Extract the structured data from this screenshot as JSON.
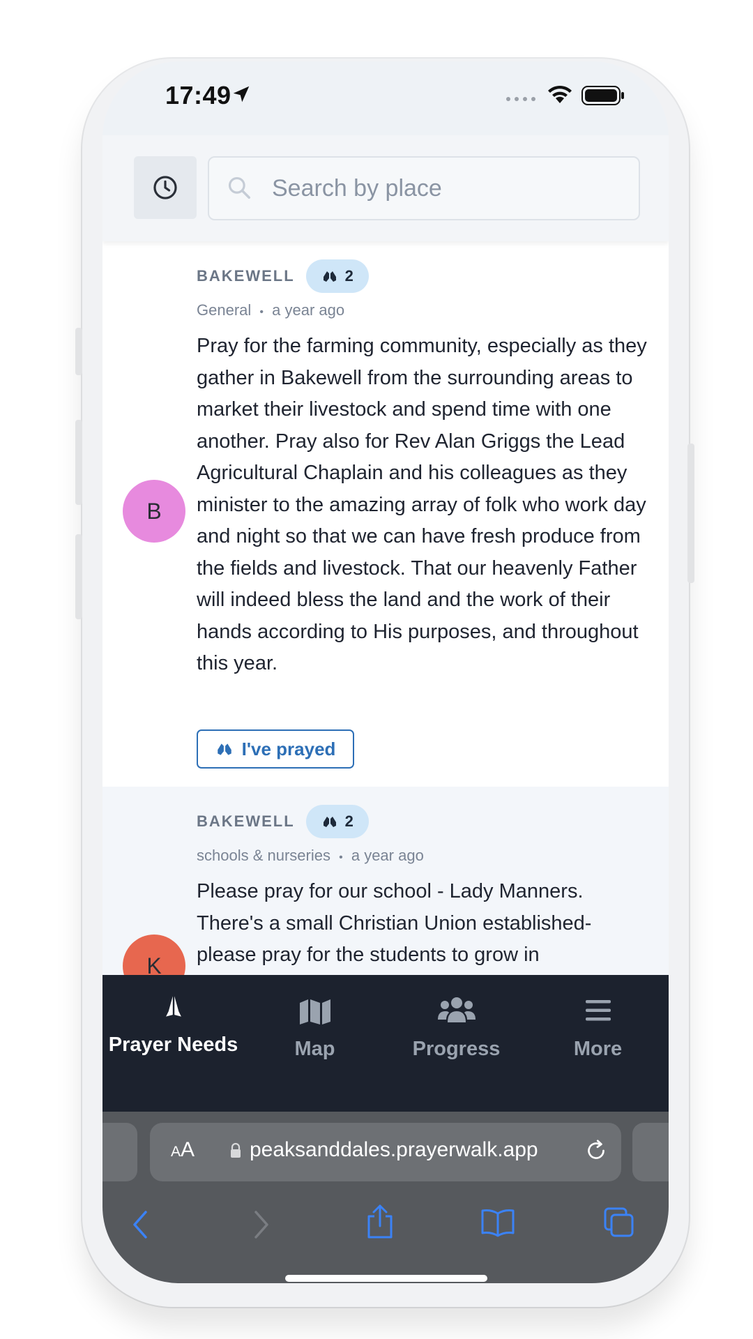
{
  "status_bar": {
    "time": "17:49"
  },
  "search": {
    "placeholder": "Search by place"
  },
  "posts": [
    {
      "avatar_letter": "B",
      "avatar_color": "#e78ade",
      "place": "BAKEWELL",
      "prayer_count": "2",
      "category": "General",
      "age": "a year ago",
      "text": "Pray for the farming community, especially as they gather in Bakewell from the surrounding areas to market their livestock and spend time with one another. Pray also for Rev Alan Griggs the Lead Agricultural Chaplain and his colleagues as they minister to the amazing array of folk who work day and night so that we can have fresh produce from the fields and livestock. That our heavenly Father will indeed bless the land and the work of their hands according to His purposes, and throughout this year.",
      "action_label": "I've prayed"
    },
    {
      "avatar_letter": "K",
      "avatar_color": "#e7674f",
      "place": "BAKEWELL",
      "prayer_count": "2",
      "category": "schools & nurseries",
      "age": "a year ago",
      "text": "Please pray for our school - Lady Manners. There's a small Christian Union established- please pray for the students to grow in"
    }
  ],
  "meta_separator": "•",
  "nav": {
    "items": [
      {
        "label": "Prayer Needs",
        "icon": "praying-hands-icon",
        "active": true
      },
      {
        "label": "Map",
        "icon": "map-icon",
        "active": false
      },
      {
        "label": "Progress",
        "icon": "users-icon",
        "active": false
      },
      {
        "label": "More",
        "icon": "menu-icon",
        "active": false
      }
    ]
  },
  "browser": {
    "text_size_label_small": "A",
    "text_size_label_large": "A",
    "url": "peaksanddales.prayerwalk.app"
  },
  "colors": {
    "accent": "#2d6fb6",
    "nav_background": "#1c222e",
    "badge_background": "#cfe6f8",
    "safari_blue": "#3b82f6"
  }
}
